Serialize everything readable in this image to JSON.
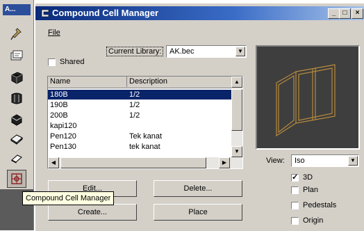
{
  "palette": {
    "title": "A...",
    "tools": [
      {
        "icon": "place-pin-icon"
      },
      {
        "icon": "cell-library-icon"
      },
      {
        "icon": "solid-block-icon"
      },
      {
        "icon": "cylinder-icon"
      },
      {
        "icon": "box-icon"
      },
      {
        "icon": "slab-icon"
      },
      {
        "icon": "eraser-icon"
      },
      {
        "icon": "compound-cell-manager-icon"
      }
    ]
  },
  "window": {
    "title": "Compound Cell Manager",
    "menu_file": "File",
    "minimize": "_",
    "maximize": "□",
    "close": "×"
  },
  "options": {
    "shared_label": "Shared",
    "shared_checked": false,
    "current_library_label": "Current Library:",
    "current_library_value": "AK.bec"
  },
  "cell_list": {
    "columns": [
      "Name",
      "Description"
    ],
    "rows": [
      {
        "name": "180B",
        "description": "1/2",
        "selected": true
      },
      {
        "name": "190B",
        "description": "1/2",
        "selected": false
      },
      {
        "name": "200B",
        "description": "1/2",
        "selected": false
      },
      {
        "name": "kapi120",
        "description": "",
        "selected": false
      },
      {
        "name": "Pen120",
        "description": "Tek kanat",
        "selected": false
      },
      {
        "name": "Pen130",
        "description": "tek kanat",
        "selected": false
      }
    ]
  },
  "buttons": {
    "edit": "Edit...",
    "delete": "Delete...",
    "create": "Create...",
    "place": "Place"
  },
  "view": {
    "label": "View:",
    "value": "Iso",
    "checks": [
      {
        "label": "3D",
        "checked": true
      },
      {
        "label": "Plan",
        "checked": false
      },
      {
        "label": "Pedestals",
        "checked": false
      },
      {
        "label": "Origin",
        "checked": false
      }
    ]
  },
  "tooltip": "Compound Cell Manager",
  "colors": {
    "titlebar_start": "#0a2a7a",
    "selection": "#0a246a",
    "preview_bg": "#3e3e3e",
    "preview_lines": "#b88a3c"
  }
}
